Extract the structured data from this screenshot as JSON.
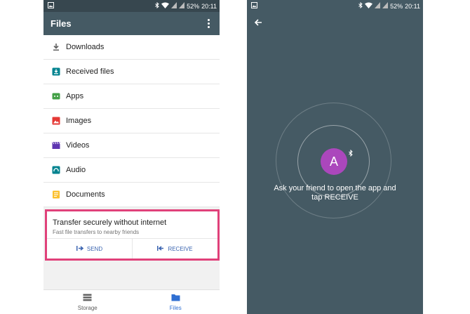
{
  "status_bar": {
    "battery": "52%",
    "time": "20:11"
  },
  "left_screen": {
    "title": "Files",
    "list": [
      {
        "label": "Downloads",
        "icon": "download-icon",
        "color": "#616161"
      },
      {
        "label": "Received files",
        "icon": "received-files-icon",
        "color": "#00838f"
      },
      {
        "label": "Apps",
        "icon": "apps-icon",
        "color": "#43a047"
      },
      {
        "label": "Images",
        "icon": "images-icon",
        "color": "#e53935"
      },
      {
        "label": "Videos",
        "icon": "videos-icon",
        "color": "#5e35b1"
      },
      {
        "label": "Audio",
        "icon": "audio-icon",
        "color": "#00838f"
      },
      {
        "label": "Documents",
        "icon": "documents-icon",
        "color": "#fbc02d"
      }
    ],
    "transfer_card": {
      "title": "Transfer securely without internet",
      "subtitle": "Fast file transfers to nearby friends",
      "send_label": "SEND",
      "receive_label": "RECEIVE",
      "highlight_color": "#e0417a"
    },
    "bottom_nav": [
      {
        "label": "Storage",
        "icon": "storage-icon",
        "active": false
      },
      {
        "label": "Files",
        "icon": "folder-icon",
        "active": true
      }
    ]
  },
  "right_screen": {
    "avatar_letter": "A",
    "avatar_color": "#ab47bc",
    "message_line1": "Ask your friend to open the app and",
    "message_line2": "tap RECEIVE"
  }
}
